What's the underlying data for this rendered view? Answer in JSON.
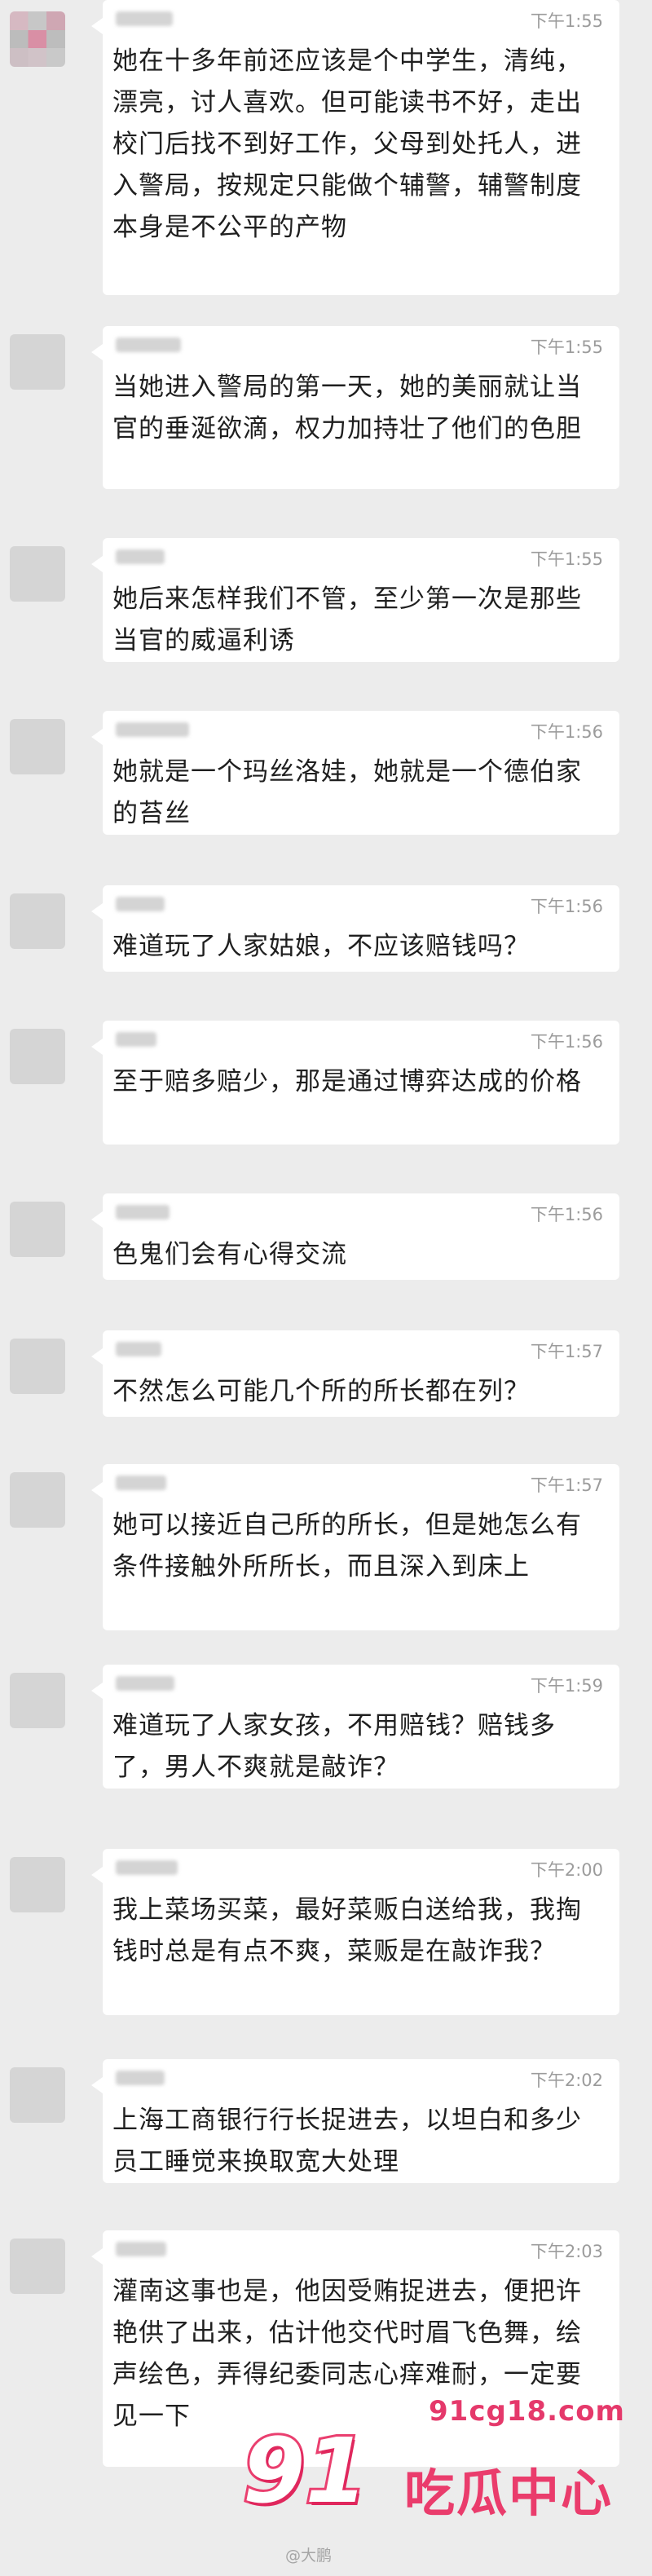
{
  "messages": [
    {
      "time": "下午1:55",
      "text": "她在十多年前还应该是个中学生，清纯，漂亮，讨人喜欢。但可能读书不好，走出校门后找不到好工作，父母到处托人，进入警局，按规定只能做个辅警，辅警制度本身是不公平的产物"
    },
    {
      "time": "下午1:55",
      "text": "当她进入警局的第一天，她的美丽就让当官的垂涎欲滴，权力加持壮了他们的色胆"
    },
    {
      "time": "下午1:55",
      "text": "她后来怎样我们不管，至少第一次是那些当官的威逼利诱"
    },
    {
      "time": "下午1:56",
      "text": "她就是一个玛丝洛娃，她就是一个德伯家的苔丝"
    },
    {
      "time": "下午1:56",
      "text": "难道玩了人家姑娘，不应该赔钱吗？"
    },
    {
      "time": "下午1:56",
      "text": "至于赔多赔少，那是通过博弈达成的价格"
    },
    {
      "time": "下午1:56",
      "text": "色鬼们会有心得交流"
    },
    {
      "time": "下午1:57",
      "text": "不然怎么可能几个所的所长都在列？"
    },
    {
      "time": "下午1:57",
      "text": "她可以接近自己所的所长，但是她怎么有条件接触外所所长，而且深入到床上"
    },
    {
      "time": "下午1:59",
      "text": "难道玩了人家女孩，不用赔钱？赔钱多了，男人不爽就是敲诈？"
    },
    {
      "time": "下午2:00",
      "text": "我上菜场买菜，最好菜贩白送给我，我掏钱时总是有点不爽，菜贩是在敲诈我？"
    },
    {
      "time": "下午2:02",
      "text": "上海工商银行行长捉进去，以坦白和多少员工睡觉来换取宽大处理"
    },
    {
      "time": "下午2:03",
      "text": "灌南这事也是，他因受贿捉进去，便把许艳供了出来，估计他交代时眉飞色舞，绘声绘色，弄得纪委同志心痒难耐，一定要见一下"
    }
  ],
  "watermark": {
    "url": "91cg18.com",
    "logo_number": "91",
    "site_name": "吃瓜中心",
    "footer": "@大鹏"
  },
  "colors": {
    "background": "#ececec",
    "bubble": "#ffffff",
    "timestamp": "#9c9c9c",
    "watermark_accent": "#ea3c6c"
  }
}
